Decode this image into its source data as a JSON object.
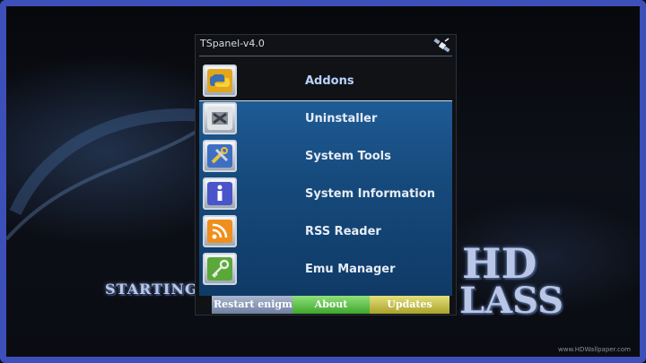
{
  "panel": {
    "title": "TSpanel-v4.0",
    "header_icon": "satellite-icon"
  },
  "menu": {
    "selected_index": 0,
    "items": [
      {
        "label": "Addons",
        "icon": "python-icon",
        "icon_color": "#e3a51c"
      },
      {
        "label": "Uninstaller",
        "icon": "uninstall-box-icon",
        "icon_color": "#8a9099"
      },
      {
        "label": "System Tools",
        "icon": "tools-icon",
        "icon_color": "#3f6fc4"
      },
      {
        "label": "System Information",
        "icon": "info-icon",
        "icon_color": "#4a55c9"
      },
      {
        "label": "RSS Reader",
        "icon": "rss-icon",
        "icon_color": "#ef8f1c"
      },
      {
        "label": "Emu Manager",
        "icon": "key-icon",
        "icon_color": "#5aa83a"
      }
    ]
  },
  "buttons": {
    "red_label": "Restart enigma",
    "green_label": "About",
    "yellow_label": "Updates"
  },
  "background": {
    "text_starting": "STARTING",
    "text_hd": "HD",
    "text_class": "LASS",
    "watermark": "www.HDWallpaper.com"
  },
  "colors": {
    "frame": "#3d4fb8",
    "list_blue": "#1e5b95",
    "about_green": "#3fa62c",
    "updates_yellow": "#a8a22a"
  }
}
